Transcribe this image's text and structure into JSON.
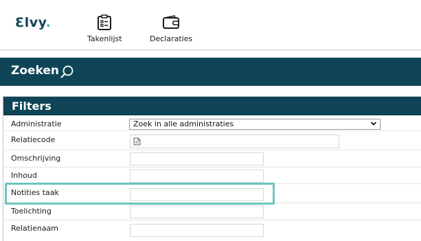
{
  "app": {
    "logo_text": "Ɛlvy",
    "logo_dot": ".",
    "accent_color": "#3fbab1",
    "brand_color": "#0f4556"
  },
  "nav": [
    {
      "label": "Takenlijst",
      "icon": "clipboard-list-icon"
    },
    {
      "label": "Declaraties",
      "icon": "wallet-icon"
    }
  ],
  "search_header": {
    "title": "Zoeken",
    "icon": "search-icon"
  },
  "filters": {
    "title": "Filters",
    "fields": [
      {
        "label": "Administratie",
        "type": "select",
        "value": "Zoek in alle administraties"
      },
      {
        "label": "Relatiecode",
        "type": "lookup",
        "value": ""
      },
      {
        "label": "Omschrijving",
        "type": "text",
        "value": ""
      },
      {
        "label": "Inhoud",
        "type": "text",
        "value": ""
      },
      {
        "label": "Notities taak",
        "type": "text",
        "value": "",
        "highlighted": true
      },
      {
        "label": "Toelichting",
        "type": "text",
        "value": ""
      },
      {
        "label": "Relatienaam",
        "type": "text",
        "value": ""
      }
    ]
  }
}
